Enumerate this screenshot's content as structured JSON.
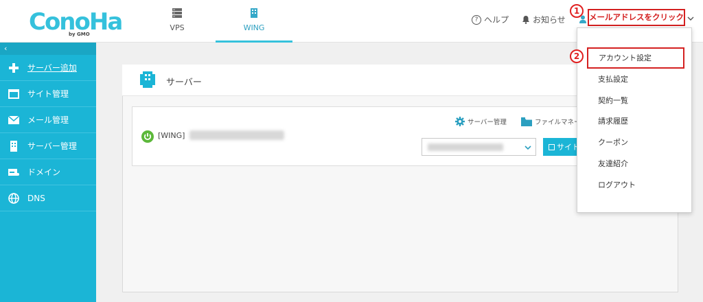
{
  "brand": {
    "logo_text": "ConoHa",
    "logo_sub": "by GMO"
  },
  "nav_tabs": [
    {
      "label": "VPS",
      "active": false
    },
    {
      "label": "WING",
      "active": true
    }
  ],
  "header": {
    "help_label": "ヘルプ",
    "notice_label": "お知らせ",
    "email_button_label": "メールアドレスをクリック",
    "marker1": "1",
    "marker2": "2"
  },
  "sidebar": {
    "collapse_label": "‹",
    "items": [
      {
        "label": "サーバー追加",
        "icon": "plus-icon"
      },
      {
        "label": "サイト管理",
        "icon": "window-icon"
      },
      {
        "label": "メール管理",
        "icon": "mail-icon"
      },
      {
        "label": "サーバー管理",
        "icon": "server-icon"
      },
      {
        "label": "ドメイン",
        "icon": "domain-icon"
      },
      {
        "label": "DNS",
        "icon": "globe-icon"
      }
    ]
  },
  "main": {
    "panel_title": "サーバー",
    "server_name": "[WING]",
    "server_mgmt_link": "サーバー管理",
    "file_manager_link": "ファイルマネー",
    "site_button_label": "サイト"
  },
  "dropdown": {
    "items": [
      "アカウント設定",
      "支払設定",
      "契約一覧",
      "請求履歴",
      "クーポン",
      "友達紹介",
      "ログアウト"
    ]
  },
  "colors": {
    "accent": "#1bb5d6",
    "highlight_red": "#d42020"
  }
}
